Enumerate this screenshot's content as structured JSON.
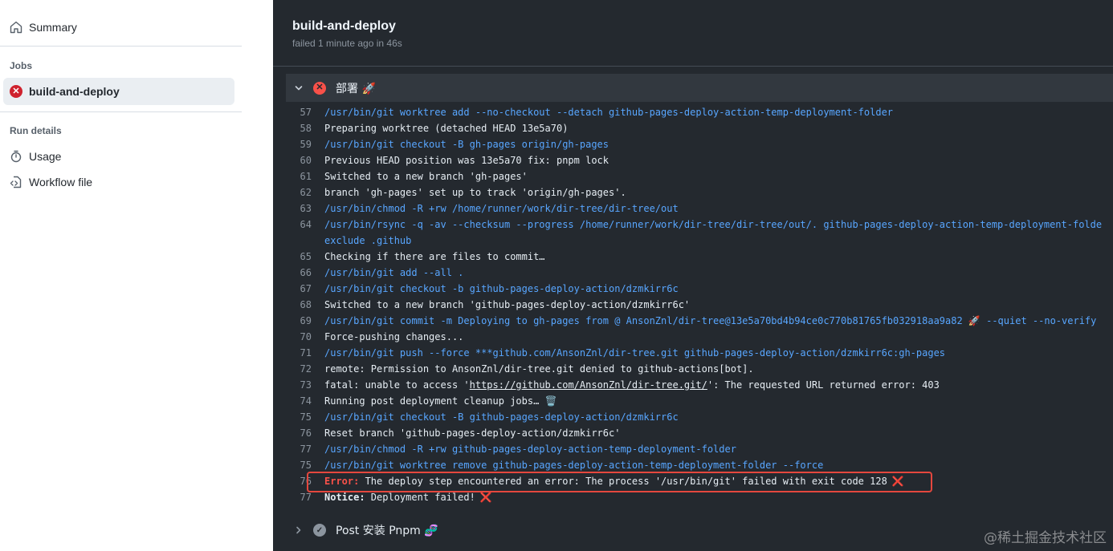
{
  "sidebar": {
    "summary_label": "Summary",
    "jobs_heading": "Jobs",
    "job_label": "build-and-deploy",
    "run_details_heading": "Run details",
    "usage_label": "Usage",
    "workflow_label": "Workflow file"
  },
  "job": {
    "title": "build-and-deploy",
    "status": "failed 1 minute ago in 46s"
  },
  "step": {
    "name": "部署 🚀",
    "footer_name": "Post 安装 Pnpm 🧬"
  },
  "log": [
    {
      "n": "57",
      "cmd": "/usr/bin/git worktree add --no-checkout --detach github-pages-deploy-action-temp-deployment-folder",
      "text": ""
    },
    {
      "n": "58",
      "cmd": "",
      "text": "Preparing worktree (detached HEAD 13e5a70)"
    },
    {
      "n": "59",
      "cmd": "/usr/bin/git checkout -B gh-pages origin/gh-pages",
      "text": ""
    },
    {
      "n": "60",
      "cmd": "",
      "text": "Previous HEAD position was 13e5a70 fix: pnpm lock"
    },
    {
      "n": "61",
      "cmd": "",
      "text": "Switched to a new branch 'gh-pages'"
    },
    {
      "n": "62",
      "cmd": "",
      "text": "branch 'gh-pages' set up to track 'origin/gh-pages'."
    },
    {
      "n": "63",
      "cmd": "/usr/bin/chmod -R +rw /home/runner/work/dir-tree/dir-tree/out",
      "text": ""
    },
    {
      "n": "64",
      "cmd": "/usr/bin/rsync -q -av --checksum --progress /home/runner/work/dir-tree/dir-tree/out/. github-pages-deploy-action-temp-deployment-folde",
      "text": ""
    },
    {
      "n": "",
      "cmd": "exclude .github",
      "text": ""
    },
    {
      "n": "65",
      "cmd": "",
      "text": "Checking if there are files to commit…"
    },
    {
      "n": "66",
      "cmd": "/usr/bin/git add --all .",
      "text": ""
    },
    {
      "n": "67",
      "cmd": "/usr/bin/git checkout -b github-pages-deploy-action/dzmkirr6c",
      "text": ""
    },
    {
      "n": "68",
      "cmd": "",
      "text": "Switched to a new branch 'github-pages-deploy-action/dzmkirr6c'"
    },
    {
      "n": "69",
      "cmd": "/usr/bin/git commit -m Deploying to gh-pages from @ AnsonZnl/dir-tree@13e5a70bd4b94ce0c770b81765fb032918aa9a82 🚀 --quiet --no-verify",
      "text": ""
    },
    {
      "n": "70",
      "cmd": "",
      "text": "Force-pushing changes..."
    },
    {
      "n": "71",
      "cmd": "/usr/bin/git push --force ***github.com/AnsonZnl/dir-tree.git github-pages-deploy-action/dzmkirr6c:gh-pages",
      "text": ""
    },
    {
      "n": "72",
      "cmd": "",
      "text": "remote: Permission to AnsonZnl/dir-tree.git denied to github-actions[bot]."
    },
    {
      "n": "73",
      "cmd": "",
      "text": "fatal: unable to access '",
      "link": "https://github.com/AnsonZnl/dir-tree.git/",
      "after": "': The requested URL returned error: 403"
    },
    {
      "n": "74",
      "cmd": "",
      "text": "Running post deployment cleanup jobs… 🗑️"
    },
    {
      "n": "75",
      "cmd": "/usr/bin/git checkout -B github-pages-deploy-action/dzmkirr6c",
      "text": ""
    },
    {
      "n": "76",
      "cmd": "",
      "text": "Reset branch 'github-pages-deploy-action/dzmkirr6c'"
    },
    {
      "n": "77",
      "cmd": "/usr/bin/chmod -R +rw github-pages-deploy-action-temp-deployment-folder",
      "text": ""
    },
    {
      "n": "75",
      "cmd": "/usr/bin/git worktree remove github-pages-deploy-action-temp-deployment-folder --force",
      "text": ""
    },
    {
      "n": "76",
      "cmd": "",
      "label": "Error:",
      "label_kind": "error",
      "text": " The deploy step encountered an error: The process '/usr/bin/git' failed with exit code 128",
      "x": "❌"
    },
    {
      "n": "77",
      "cmd": "",
      "label": "Notice:",
      "label_kind": "notice",
      "text": " Deployment failed!",
      "x": "❌"
    }
  ],
  "watermark": "@稀土掘金技术社区",
  "colors": {
    "panel_bg": "#24292f",
    "command_blue": "#58a6ff",
    "error_red": "#f85149",
    "highlight_border": "#e5473e"
  }
}
